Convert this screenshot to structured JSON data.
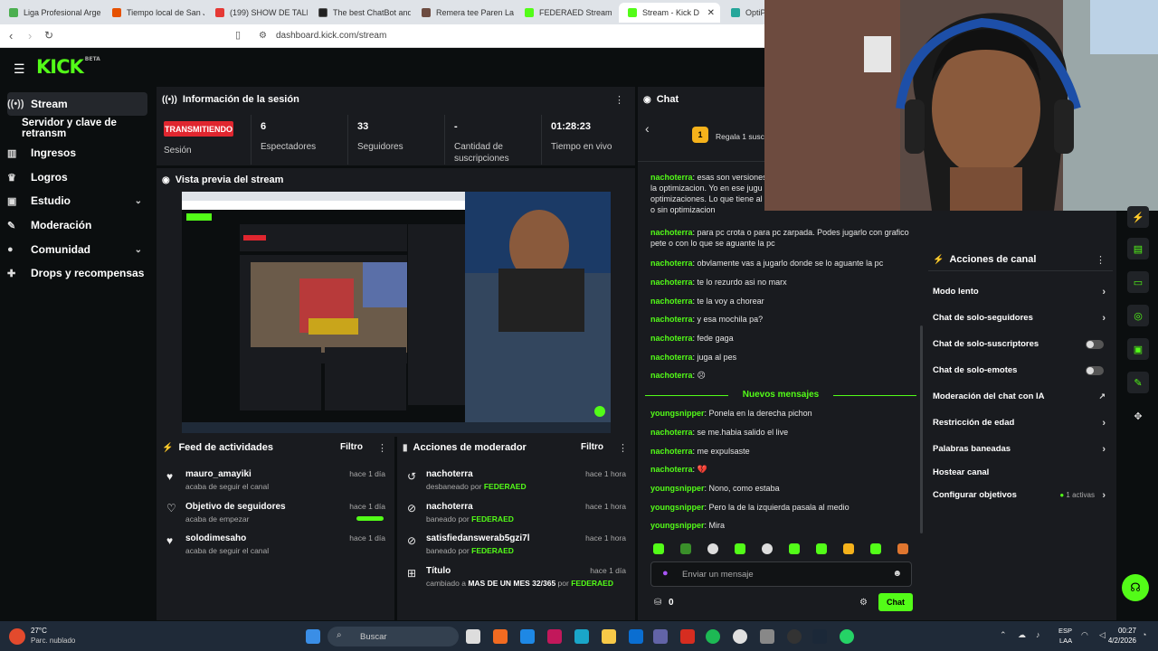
{
  "browser": {
    "tabs": [
      {
        "label": "Liga Profesional Argen",
        "color": "#4caf50"
      },
      {
        "label": "Tiempo local de San Ju",
        "color": "#e65100"
      },
      {
        "label": "(199) SHOW DE TALEN",
        "color": "#e53935"
      },
      {
        "label": "The best ChatBot and",
        "color": "#212121"
      },
      {
        "label": "Remera tee Paren La M",
        "color": "#6d4c41"
      },
      {
        "label": "FEDERAED Stream",
        "color": "#53fc18"
      },
      {
        "label": "Stream - Kick D",
        "color": "#53fc18"
      },
      {
        "label": "OptiP",
        "color": "#26a69a"
      }
    ],
    "url": "dashboard.kick.com/stream"
  },
  "app": {
    "logo": "KICK",
    "logo_sup": "BETA"
  },
  "sidebar": {
    "items": [
      {
        "label": "Stream",
        "icon": "stream-icon"
      },
      {
        "label": "Servidor y clave de retransm",
        "icon": ""
      },
      {
        "label": "Ingresos",
        "icon": "chart-icon"
      },
      {
        "label": "Logros",
        "icon": "trophy-icon"
      },
      {
        "label": "Estudio",
        "icon": "studio-icon"
      },
      {
        "label": "Moderación",
        "icon": "wrench-icon"
      },
      {
        "label": "Comunidad",
        "icon": "community-icon"
      },
      {
        "label": "Drops y recompensas",
        "icon": "gift-icon"
      }
    ]
  },
  "session": {
    "title": "Información de la sesión",
    "live_badge": "TRANSMITIENDO",
    "sesion_label": "Sesión",
    "viewers": "6",
    "viewers_label": "Espectadores",
    "followers": "33",
    "followers_label": "Seguidores",
    "subs": "-",
    "subs_label": "Cantidad de suscripciones",
    "time": "01:28:23",
    "time_label": "Tiempo en vivo"
  },
  "preview": {
    "title": "Vista previa del stream"
  },
  "activity": {
    "title": "Feed de actividades",
    "filter": "Filtro",
    "items": [
      {
        "name": "mauro_amayiki",
        "sub": "acaba de seguir el canal",
        "time": "hace 1 día"
      },
      {
        "name": "Objetivo de seguidores",
        "sub": "acaba de empezar",
        "time": "hace 1 día"
      },
      {
        "name": "solodimesaho",
        "sub": "acaba de seguir el canal",
        "time": "hace 1 día"
      }
    ]
  },
  "modactions": {
    "title": "Acciones de moderador",
    "filter": "Filtro",
    "items": [
      {
        "name": "nachoterra",
        "action": "desbaneado por",
        "by": "FEDERAED",
        "time": "hace 1 hora"
      },
      {
        "name": "nachoterra",
        "action": "baneado por",
        "by": "FEDERAED",
        "time": "hace 1 hora"
      },
      {
        "name": "satisfiedanswerab5gzi7l",
        "action": "baneado por",
        "by": "FEDERAED",
        "time": "hace 1 hora"
      },
      {
        "name": "Título",
        "action": "cambiado a",
        "extra": "MAS DE UN MES 32/365",
        "by_prefix": "por",
        "by": "FEDERAED",
        "time": "hace 1 día"
      }
    ]
  },
  "chat": {
    "title": "Chat",
    "gift_badge": "1",
    "gift_text": "Regala 1 suscr",
    "messages": [
      {
        "user": "nachoterra",
        "text": "esas son versiones la optimizacion. Yo en ese jugu optimizaciones. Lo que tiene al o sin optimizacion"
      },
      {
        "user": "nachoterra",
        "text": "para pc crota o para pc zarpada. Podes jugarlo con grafico pete o con lo que se aguante la pc"
      },
      {
        "user": "nachoterra",
        "text": "obvlamente vas a jugarlo donde se lo aguante la pc"
      },
      {
        "user": "nachoterra",
        "text": "te lo rezurdo asi no marx"
      },
      {
        "user": "nachoterra",
        "text": "te la voy a chorear"
      },
      {
        "user": "nachoterra",
        "text": "y esa mochila pa?"
      },
      {
        "user": "nachoterra",
        "text": "fede gaga"
      },
      {
        "user": "nachoterra",
        "text": "juga al pes"
      },
      {
        "user": "nachoterra",
        "text": "☹"
      }
    ],
    "new_label": "Nuevos mensajes",
    "new_messages": [
      {
        "user": "youngsnipper",
        "text": "Ponela en la derecha pichon"
      },
      {
        "user": "nachoterra",
        "text": "se me.habia salido el live"
      },
      {
        "user": "nachoterra",
        "text": "me expulsaste"
      },
      {
        "user": "nachoterra",
        "text": "💔"
      },
      {
        "user": "youngsnipper",
        "text": "Nono, como estaba"
      },
      {
        "user": "youngsnipper",
        "text": "Pero la de la izquierda pasala al medio"
      },
      {
        "user": "youngsnipper",
        "text": "Mira"
      }
    ],
    "input_placeholder": "Enviar un mensaje",
    "points": "0",
    "send": "Chat"
  },
  "channel_actions": {
    "title": "Acciones de canal",
    "items": [
      {
        "label": "Modo lento",
        "type": "arrow"
      },
      {
        "label": "Chat de solo-seguidores",
        "type": "arrow"
      },
      {
        "label": "Chat de solo-suscriptores",
        "type": "toggle"
      },
      {
        "label": "Chat de solo-emotes",
        "type": "toggle"
      },
      {
        "label": "Moderación del chat con IA",
        "type": "link"
      },
      {
        "label": "Restricción de edad",
        "type": "arrow"
      },
      {
        "label": "Palabras baneadas",
        "type": "arrow"
      },
      {
        "label": "Hostear canal",
        "type": "none"
      },
      {
        "label": "Configurar objetivos",
        "type": "arrow",
        "extra": "1 activas"
      }
    ]
  },
  "taskbar": {
    "weather_temp": "27°C",
    "weather_desc": "Parc. nublado",
    "search": "Buscar",
    "lang": "ESP",
    "lang2": "LAA",
    "time": "00:27",
    "date": "4/2/2026"
  },
  "colors": {
    "accent": "#53fc18",
    "live": "#e0262f",
    "panel": "#191b1f",
    "bg": "#0b0e0f"
  }
}
